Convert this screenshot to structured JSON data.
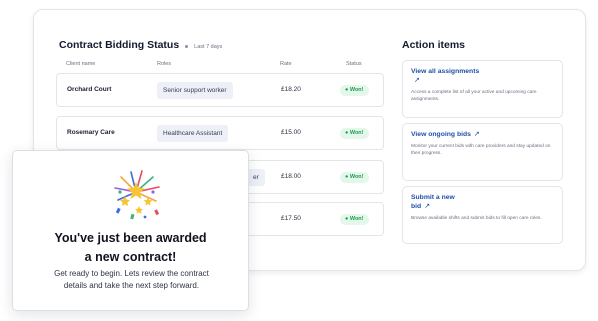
{
  "bidding": {
    "title": "Contract Bidding Status",
    "range": "Last 7 days",
    "headers": {
      "client": "Client name",
      "roles": "Roles",
      "rate": "Rate",
      "status": "Status"
    },
    "rows": [
      {
        "client": "Orchard Court",
        "role": "Senior support worker",
        "rate": "£18.20",
        "status": "Won!"
      },
      {
        "client": "Rosemary Care",
        "role": "Healthcare Assistant",
        "rate": "£15.00",
        "status": "Won!"
      },
      {
        "client": "",
        "role": "er",
        "rate": "£18.00",
        "status": "Won!"
      },
      {
        "client": "",
        "role": "",
        "rate": "£17.50",
        "status": "Won!"
      }
    ]
  },
  "actions": {
    "title": "Action items",
    "items": [
      {
        "link": "View all assignments",
        "desc": "Access a complete list of all your active and upcoming care assignments."
      },
      {
        "link": "View ongoing bids",
        "desc": "Monitor your current bids with care providers and stay updated on their progress."
      },
      {
        "link": "Submit a new bid",
        "desc": "Browse available shifts and submit bids to fill open care roles."
      }
    ]
  },
  "modal": {
    "heading_line1": "You've just been awarded",
    "heading_line2": "a new contract!",
    "sub_line1": "Get ready to begin. Lets review the contract",
    "sub_line2": "details and take the next step forward."
  },
  "colors": {
    "link": "#1e4fa8",
    "status_bg": "#e3f7ea",
    "status_text": "#1f9b4f"
  }
}
